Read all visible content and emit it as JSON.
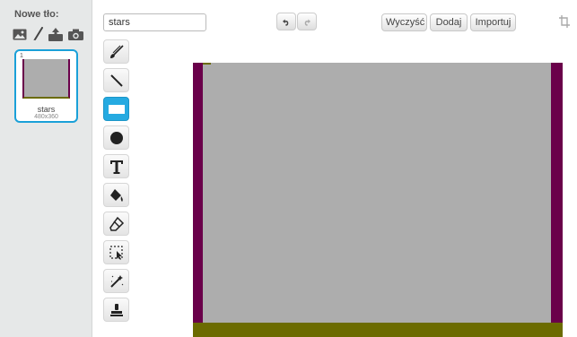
{
  "sidebar": {
    "title": "Nowe tło:",
    "backdrops": [
      {
        "index": "1",
        "name": "stars",
        "size": "480x360"
      }
    ]
  },
  "editor": {
    "costume_name": "stars",
    "buttons": {
      "clear": "Wyczyść",
      "add": "Dodaj",
      "import": "Importuj"
    },
    "tools": [
      "brush",
      "line",
      "rectangle",
      "ellipse",
      "text",
      "fill",
      "eraser",
      "select",
      "reshape",
      "stamp"
    ],
    "selected_tool": "rectangle"
  },
  "colors": {
    "accent": "#25aae1",
    "canvas_fill": "#adadad",
    "purple": "#6a004a",
    "olive": "#6b6b00"
  }
}
